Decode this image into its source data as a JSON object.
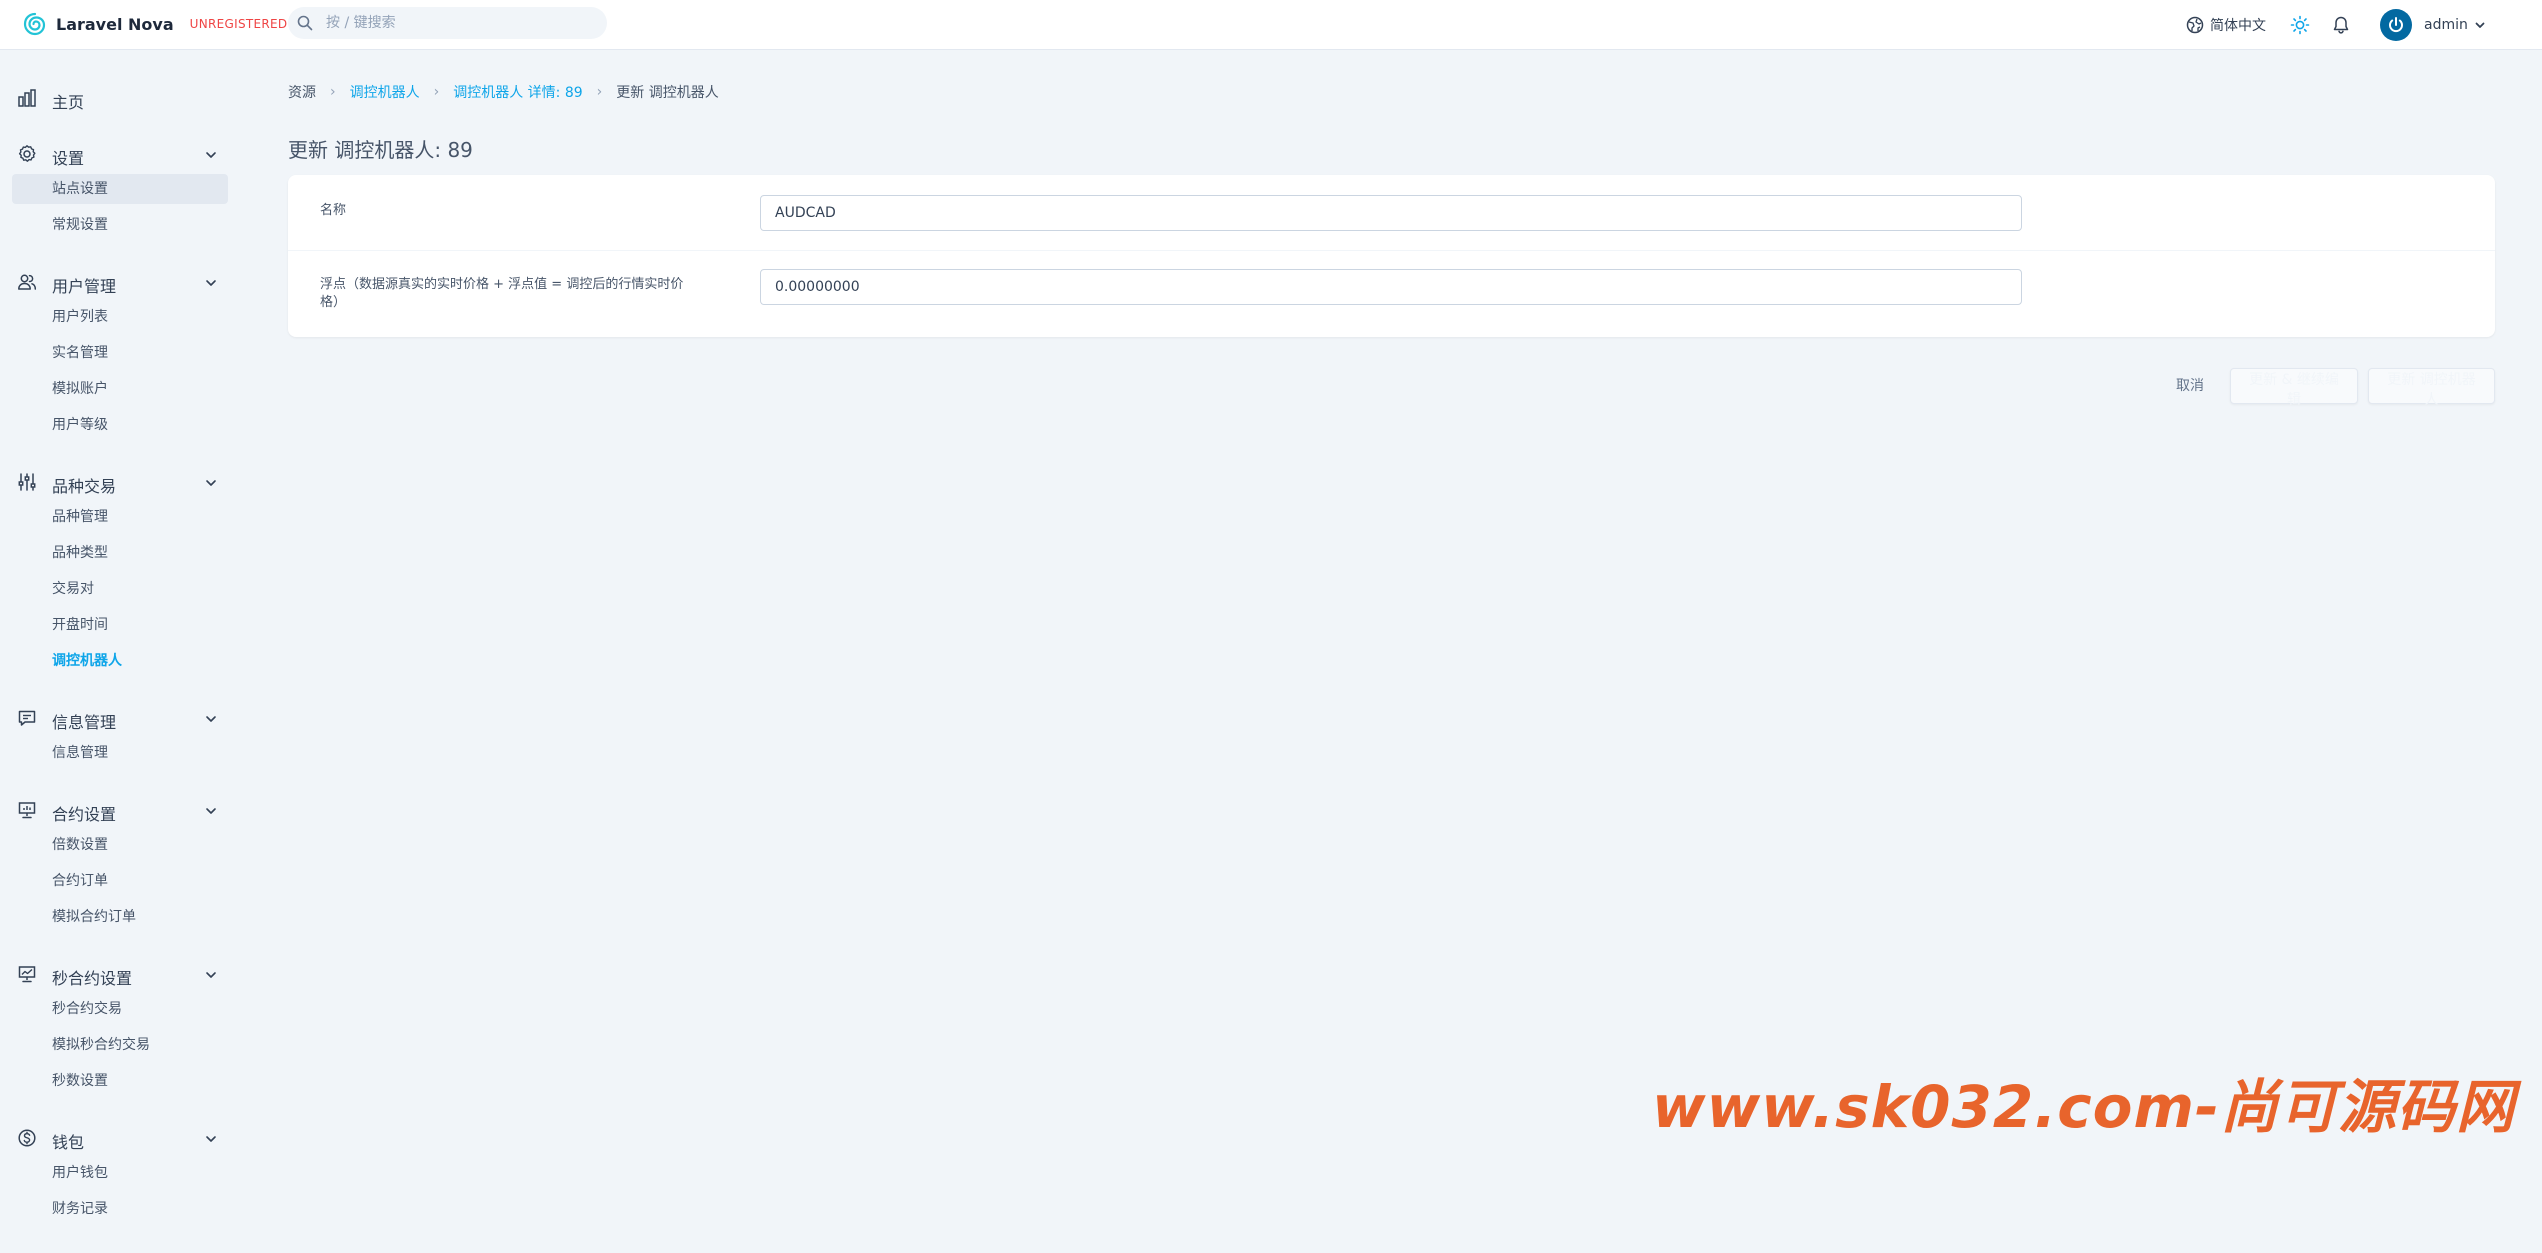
{
  "header": {
    "brand_name": "Laravel Nova",
    "brand_tag": "UNREGISTERED",
    "search_placeholder": "按 / 键搜索",
    "language": "简体中文",
    "user_name": "admin",
    "icons": [
      "nova-logo-icon",
      "search-icon",
      "globe-icon",
      "sun-icon",
      "bell-icon",
      "power-avatar-icon",
      "chevron-down-icon"
    ]
  },
  "sidebar": {
    "dashboard": "主页",
    "groups": [
      {
        "label": "设置",
        "icon": "gear-icon",
        "items": [
          "站点设置",
          "常规设置"
        ]
      },
      {
        "label": "用户管理",
        "icon": "users-icon",
        "items": [
          "用户列表",
          "实名管理",
          "模拟账户",
          "用户等级"
        ]
      },
      {
        "label": "品种交易",
        "icon": "adjustments-icon",
        "items": [
          "品种管理",
          "品种类型",
          "交易对",
          "开盘时间",
          "调控机器人"
        ]
      },
      {
        "label": "信息管理",
        "icon": "chat-icon",
        "items": [
          "信息管理"
        ]
      },
      {
        "label": "合约设置",
        "icon": "presentation-icon",
        "items": [
          "倍数设置",
          "合约订单",
          "模拟合约订单"
        ]
      },
      {
        "label": "秒合约设置",
        "icon": "trend-chart-icon",
        "items": [
          "秒合约交易",
          "模拟秒合约交易",
          "秒数设置"
        ]
      },
      {
        "label": "钱包",
        "icon": "dollar-icon",
        "items": [
          "用户钱包",
          "财务记录"
        ]
      }
    ]
  },
  "breadcrumb": [
    "资源",
    "调控机器人",
    "调控机器人 详情: 89",
    "更新 调控机器人"
  ],
  "page_title": "更新 调控机器人: 89",
  "form": {
    "name_label": "名称",
    "name_value": "AUDCAD",
    "float_label": "浮点（数据源真实的实时价格 + 浮点值 = 调控后的行情实时价格）",
    "float_value": "0.00000000"
  },
  "actions": {
    "cancel": "取消",
    "update_continue": "更新 & 继续编辑",
    "update": "更新 调控机器人"
  },
  "watermark": "www.sk032.com-尚可源码网",
  "colors": {
    "accent": "#0ea5e9",
    "unregistered": "#ef4444",
    "watermark": "#e8642c",
    "avatar": "#0369a1"
  }
}
